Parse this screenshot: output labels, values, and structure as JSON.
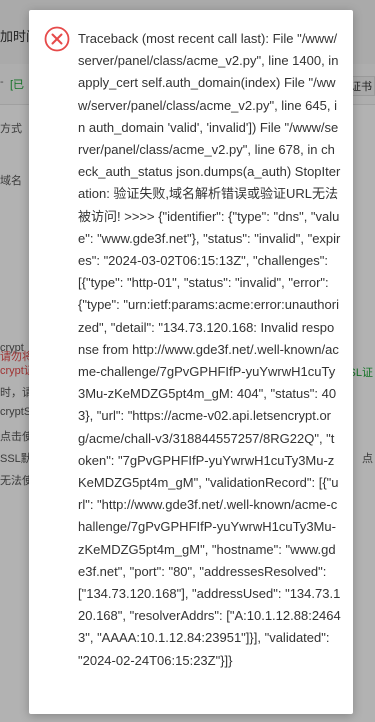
{
  "background": {
    "title_fragment": "加时间",
    "tab_fragment": "[已",
    "dash": "-",
    "right_tab_fragment": "证书",
    "left_labels": [
      {
        "text": "方式",
        "class": ""
      },
      {
        "text": "域名",
        "class": ""
      },
      {
        "text": "请勿将S",
        "class": "red"
      },
      {
        "text": "crypt",
        "class": ""
      },
      {
        "text": "crypt证",
        "class": "red"
      },
      {
        "text": "时，请确",
        "class": ""
      },
      {
        "text": "cryptS",
        "class": ""
      },
      {
        "text": "点击使用",
        "class": ""
      },
      {
        "text": "SSL默",
        "class": ""
      },
      {
        "text": "无法使",
        "class": ""
      }
    ],
    "right_labels": [
      {
        "text": "SSL证",
        "class": "green"
      },
      {
        "text": "点",
        "class": ""
      }
    ]
  },
  "dialog": {
    "icon": "error-circle-x-icon",
    "icon_color": "#e64a4a",
    "message": "Traceback (most recent call last): File \"/www/server/panel/class/acme_v2.py\", line 1400, in apply_cert self.auth_domain(index) File \"/www/server/panel/class/acme_v2.py\", line 645, in auth_domain 'valid', 'invalid']) File \"/www/server/panel/class/acme_v2.py\", line 678, in check_auth_status json.dumps(a_auth) StopIteration: 验证失败,域名解析错误或验证URL无法被访问! >>>> {\"identifier\": {\"type\": \"dns\", \"value\": \"www.gde3f.net\"}, \"status\": \"invalid\", \"expires\": \"2024-03-02T06:15:13Z\", \"challenges\": [{\"type\": \"http-01\", \"status\": \"invalid\", \"error\": {\"type\": \"urn:ietf:params:acme:error:unauthorized\", \"detail\": \"134.73.120.168: Invalid response from http://www.gde3f.net/.well-known/acme-challenge/7gPvGPHFIfP-yuYwrwH1cuTy3Mu-zKeMDZG5pt4m_gM: 404\", \"status\": 403}, \"url\": \"https://acme-v02.api.letsencrypt.org/acme/chall-v3/318844557257/8RG22Q\", \"token\": \"7gPvGPHFIfP-yuYwrwH1cuTy3Mu-zKeMDZG5pt4m_gM\", \"validationRecord\": [{\"url\": \"http://www.gde3f.net/.well-known/acme-challenge/7gPvGPHFIfP-yuYwrwH1cuTy3Mu-zKeMDZG5pt4m_gM\", \"hostname\": \"www.gde3f.net\", \"port\": \"80\", \"addressesResolved\": [\"134.73.120.168\"], \"addressUsed\": \"134.73.120.168\", \"resolverAddrs\": [\"A:10.1.12.88:24643\", \"AAAA:10.1.12.84:23951\"]}], \"validated\": \"2024-02-24T06:15:23Z\"}]}"
  }
}
